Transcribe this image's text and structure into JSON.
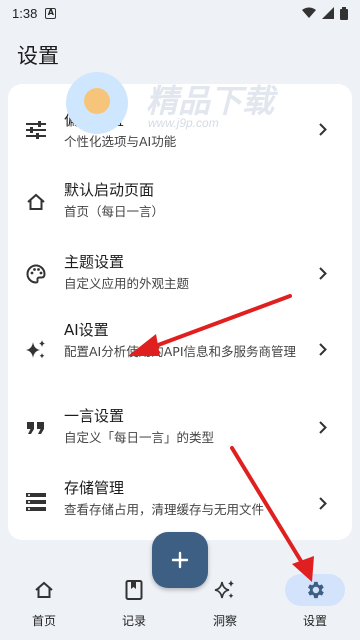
{
  "status_bar": {
    "time": "1:38"
  },
  "app_bar": {
    "title": "设置"
  },
  "watermark": {
    "brand": "精品下载",
    "url": "www.j9p.com"
  },
  "settings": [
    {
      "title": "偏好设置",
      "subtitle": "个性化选项与AI功能",
      "icon": "tune-icon",
      "has_chevron": true
    },
    {
      "title": "默认启动页面",
      "subtitle": "首页（每日一言）",
      "icon": "home-icon",
      "has_chevron": false
    },
    {
      "title": "主题设置",
      "subtitle": "自定义应用的外观主题",
      "icon": "palette-icon",
      "has_chevron": true
    },
    {
      "title": "AI设置",
      "subtitle": "配置AI分析使用的API信息和多服务商管理",
      "icon": "sparkle-icon",
      "has_chevron": true
    },
    {
      "title": "一言设置",
      "subtitle": "自定义「每日一言」的类型",
      "icon": "quote-icon",
      "has_chevron": true
    },
    {
      "title": "存储管理",
      "subtitle": "查看存储占用，清理缓存与无用文件",
      "icon": "storage-icon",
      "has_chevron": true
    }
  ],
  "fab": {
    "icon": "plus-icon"
  },
  "bottom_nav": [
    {
      "label": "首页",
      "icon": "home-icon",
      "active": false
    },
    {
      "label": "记录",
      "icon": "book-icon",
      "active": false
    },
    {
      "label": "洞察",
      "icon": "sparkle-icon",
      "active": false
    },
    {
      "label": "设置",
      "icon": "gear-icon",
      "active": true
    }
  ],
  "colors": {
    "accent": "#3e5f84",
    "active_pill": "#d3e3fb",
    "annotation_arrow": "#e02020"
  }
}
